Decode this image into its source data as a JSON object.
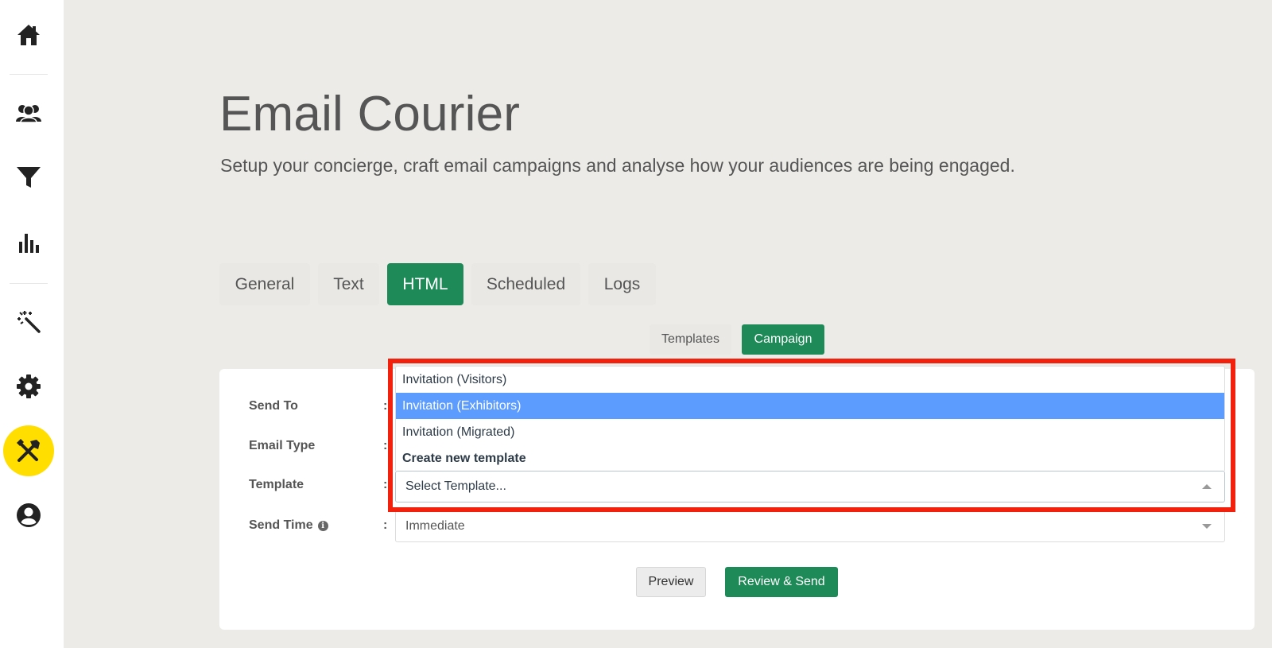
{
  "sidebar": {
    "items": [
      {
        "icon": "home-icon",
        "active": false
      },
      {
        "icon": "users-icon",
        "active": false
      },
      {
        "icon": "filter-icon",
        "active": false
      },
      {
        "icon": "bar-chart-icon",
        "active": false
      },
      {
        "icon": "magic-wand-icon",
        "active": false
      },
      {
        "icon": "gear-icon",
        "active": false
      },
      {
        "icon": "tools-icon",
        "active": true
      },
      {
        "icon": "user-account-icon",
        "active": false
      }
    ],
    "active_color": "#ffde00"
  },
  "header": {
    "title": "Email Courier",
    "subtitle": "Setup your concierge, craft email campaigns and analyse how your audiences are being engaged."
  },
  "tabs": [
    {
      "label": "General",
      "active": false
    },
    {
      "label": "Text",
      "active": false
    },
    {
      "label": "HTML",
      "active": true
    },
    {
      "label": "Scheduled",
      "active": false
    },
    {
      "label": "Logs",
      "active": false
    }
  ],
  "subtabs": [
    {
      "label": "Templates",
      "active": false
    },
    {
      "label": "Campaign",
      "active": true
    }
  ],
  "form": {
    "send_to_label": "Send To",
    "email_type_label": "Email Type",
    "template_label": "Template",
    "send_time_label": "Send Time",
    "colon": ":",
    "info_glyph": "i",
    "template_placeholder": "Select Template...",
    "send_time_value": "Immediate"
  },
  "dropdown": {
    "options": [
      {
        "label": "Invitation (Visitors)",
        "selected": false
      },
      {
        "label": "Invitation (Exhibitors)",
        "selected": true
      },
      {
        "label": "Invitation (Migrated)",
        "selected": false
      },
      {
        "label": "Create new template",
        "selected": false,
        "bold": true
      }
    ],
    "highlight_color": "#5c9cff"
  },
  "buttons": {
    "preview_label": "Preview",
    "review_send_label": "Review & Send"
  },
  "colors": {
    "accent_green": "#1d8a57",
    "annotation_red": "#f2210d",
    "background": "#edebe7"
  }
}
